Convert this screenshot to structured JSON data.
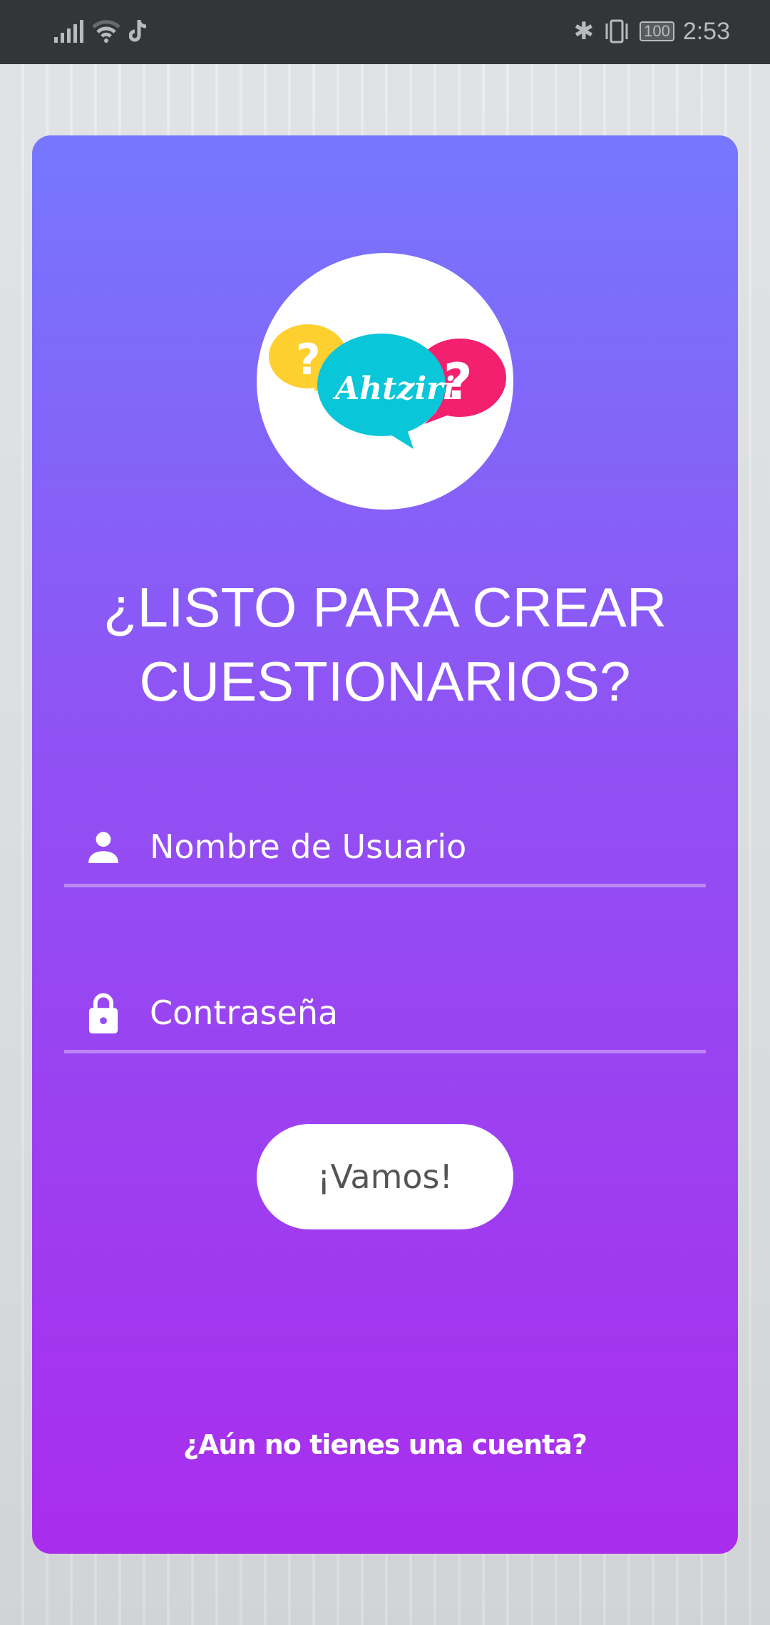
{
  "status_bar": {
    "time": "2:53",
    "battery": "100",
    "icons": [
      "signal-icon",
      "wifi-icon",
      "tiktok-icon",
      "bluetooth-icon",
      "vibrate-icon",
      "battery-icon"
    ]
  },
  "logo": {
    "text": "Ahtziri"
  },
  "title": {
    "line1": "¿LISTO PARA CREAR",
    "line2": "CUESTIONARIOS?"
  },
  "form": {
    "username_placeholder": "Nombre de Usuario",
    "password_placeholder": "Contraseña",
    "submit_label": "¡Vamos!"
  },
  "footer": {
    "signup_link": "¿Aún no tienes una cuenta?"
  },
  "colors": {
    "gradient_top": "#7677fe",
    "gradient_bottom": "#a92ded"
  }
}
